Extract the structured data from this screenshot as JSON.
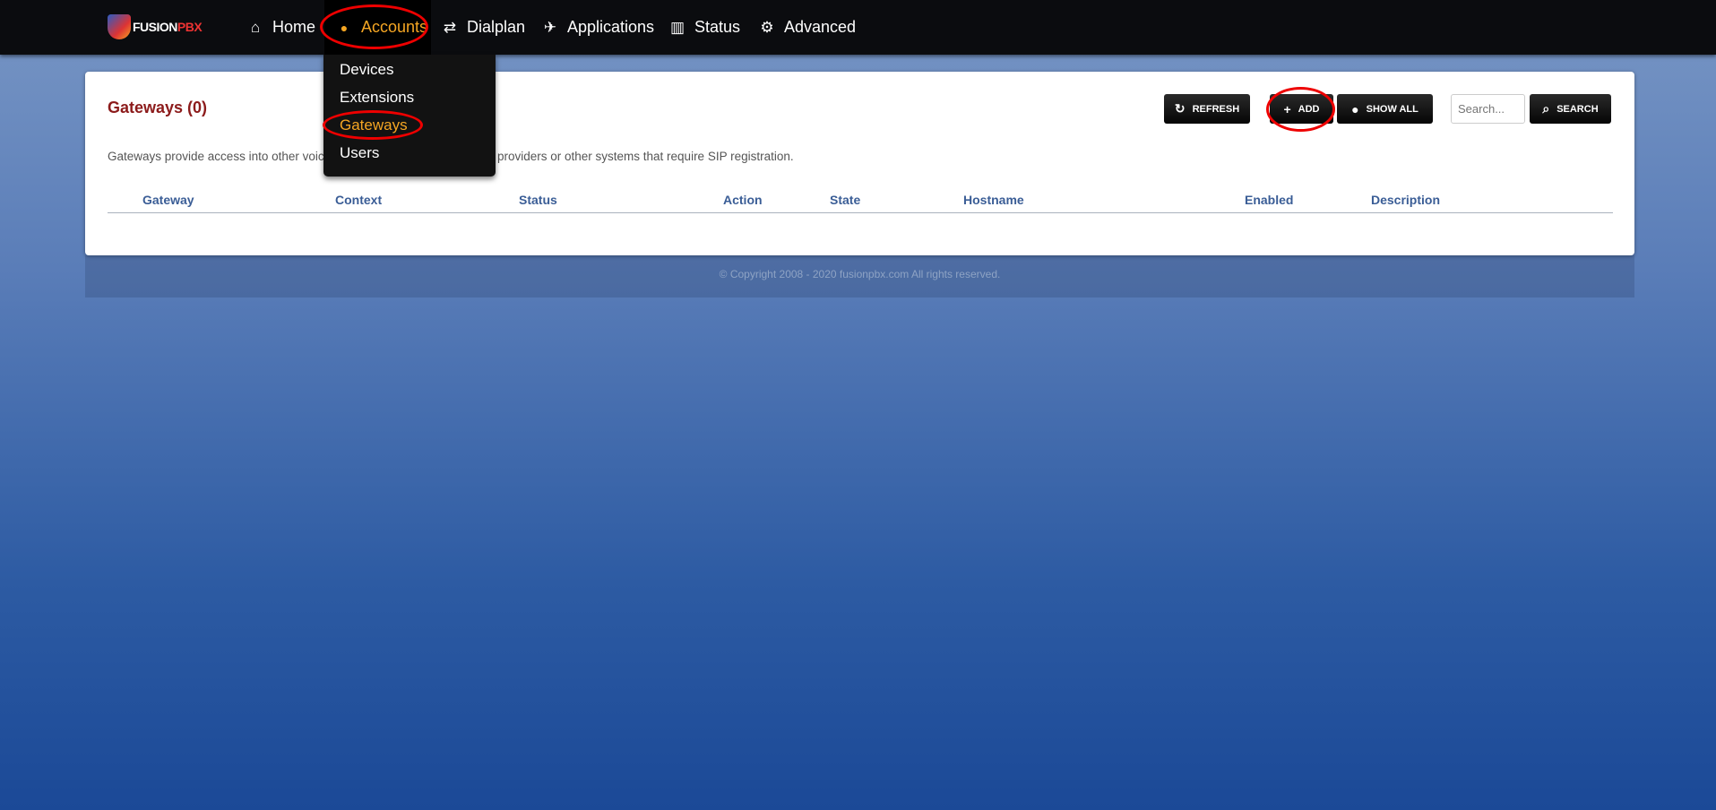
{
  "brand": {
    "logo_text_a": "FUSION",
    "logo_text_b": "PBX"
  },
  "nav": {
    "items": [
      {
        "label": "Home",
        "icon": "home-icon",
        "glyph": "⌂"
      },
      {
        "label": "Accounts",
        "icon": "user-icon",
        "glyph": "👤"
      },
      {
        "label": "Dialplan",
        "icon": "exchange-icon",
        "glyph": "⇄"
      },
      {
        "label": "Applications",
        "icon": "paper-plane-icon",
        "glyph": "✈"
      },
      {
        "label": "Status",
        "icon": "bar-chart-icon",
        "glyph": "▥"
      },
      {
        "label": "Advanced",
        "icon": "gear-icon",
        "glyph": "⚙"
      }
    ],
    "active": "Accounts"
  },
  "dropdown": {
    "items": [
      "Devices",
      "Extensions",
      "Gateways",
      "Users"
    ],
    "active": "Gateways"
  },
  "page": {
    "title": "Gateways (0)",
    "description": "Gateways provide access into other voice networks. These can be voice providers or other systems that require SIP registration."
  },
  "toolbar": {
    "refresh": "REFRESH",
    "add": "ADD",
    "show_all": "SHOW ALL",
    "search_placeholder": "Search...",
    "search": "SEARCH"
  },
  "table": {
    "columns": [
      "Gateway",
      "Context",
      "Status",
      "Action",
      "State",
      "Hostname",
      "Enabled",
      "Description"
    ],
    "rows": []
  },
  "footer": "© Copyright 2008 - 2020 fusionpbx.com All rights reserved.",
  "colors": {
    "accent": "#f5a623",
    "title": "#8c1b1b",
    "header": "#3a5d96",
    "annotation": "#e00000"
  }
}
